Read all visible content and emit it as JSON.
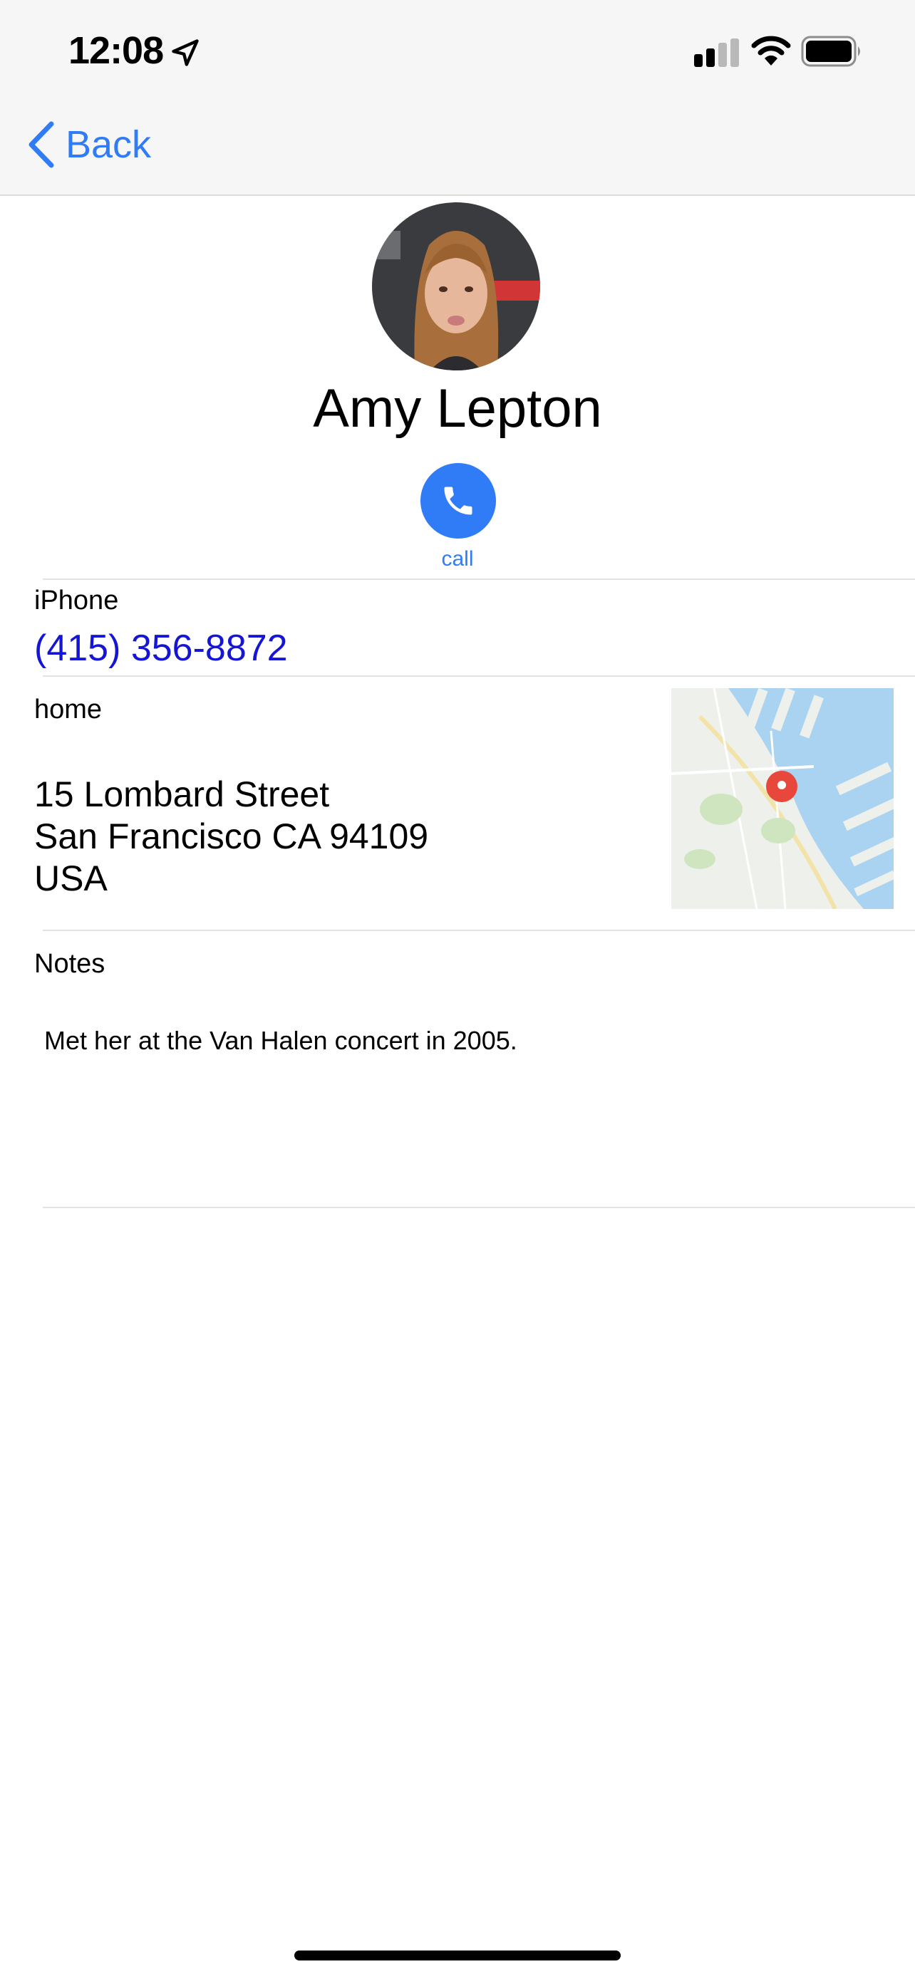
{
  "status_bar": {
    "time": "12:08"
  },
  "nav": {
    "back_label": "Back"
  },
  "contact": {
    "name": "Amy Lepton",
    "call_label": "call",
    "phone": {
      "label": "iPhone",
      "number": "(415) 356-8872"
    },
    "address": {
      "label": "home",
      "lines": [
        "15 Lombard Street",
        "San Francisco CA 94109",
        "USA"
      ]
    },
    "notes": {
      "label": "Notes",
      "text": "Met her at the Van Halen concert in 2005."
    }
  },
  "colors": {
    "accent": "#2f7cf6",
    "phone_link": "#1515d6",
    "map_pin": "#e8473c"
  },
  "icons": [
    "location-arrow-icon",
    "cellular-signal-icon",
    "wifi-icon",
    "battery-icon",
    "chevron-left-icon",
    "phone-icon",
    "map-pin-icon"
  ]
}
